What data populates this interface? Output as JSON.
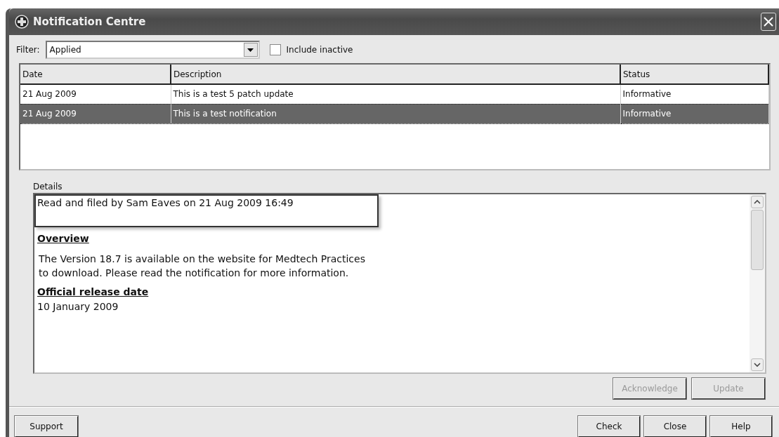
{
  "window": {
    "title": "Notification Centre"
  },
  "filter": {
    "label": "Filter:",
    "value": "Applied"
  },
  "include_inactive": {
    "label": "Include inactive",
    "checked": false
  },
  "table": {
    "columns": [
      "Date",
      "Description",
      "Status"
    ],
    "rows": [
      {
        "cells": [
          "21 Aug 2009",
          "This is a test 5 patch update",
          "Informative"
        ],
        "selected": false
      },
      {
        "cells": [
          "21 Aug 2009",
          "This is a test notification",
          "Informative"
        ],
        "selected": true
      }
    ]
  },
  "details": {
    "label": "Details",
    "filed_note": "Read and filed by Sam Eaves on 21 Aug 2009 16:49",
    "sections": [
      {
        "kind": "heading",
        "text": "Overview"
      },
      {
        "kind": "paragraph",
        "text": "The Version 18.7 is available on the website for Medtech Practices to download. Please read the notification for more information."
      },
      {
        "kind": "heading",
        "text": "Official release date"
      },
      {
        "kind": "line",
        "text": "10 January 2009"
      }
    ]
  },
  "detail_buttons": [
    {
      "label": "Acknowledge",
      "disabled": true
    },
    {
      "label": "Update",
      "disabled": true
    }
  ],
  "footer_left": [
    {
      "label": "Support",
      "disabled": false
    }
  ],
  "footer_right": [
    {
      "label": "Check",
      "disabled": false
    },
    {
      "label": "Close",
      "disabled": false
    },
    {
      "label": "Help",
      "disabled": false
    }
  ]
}
